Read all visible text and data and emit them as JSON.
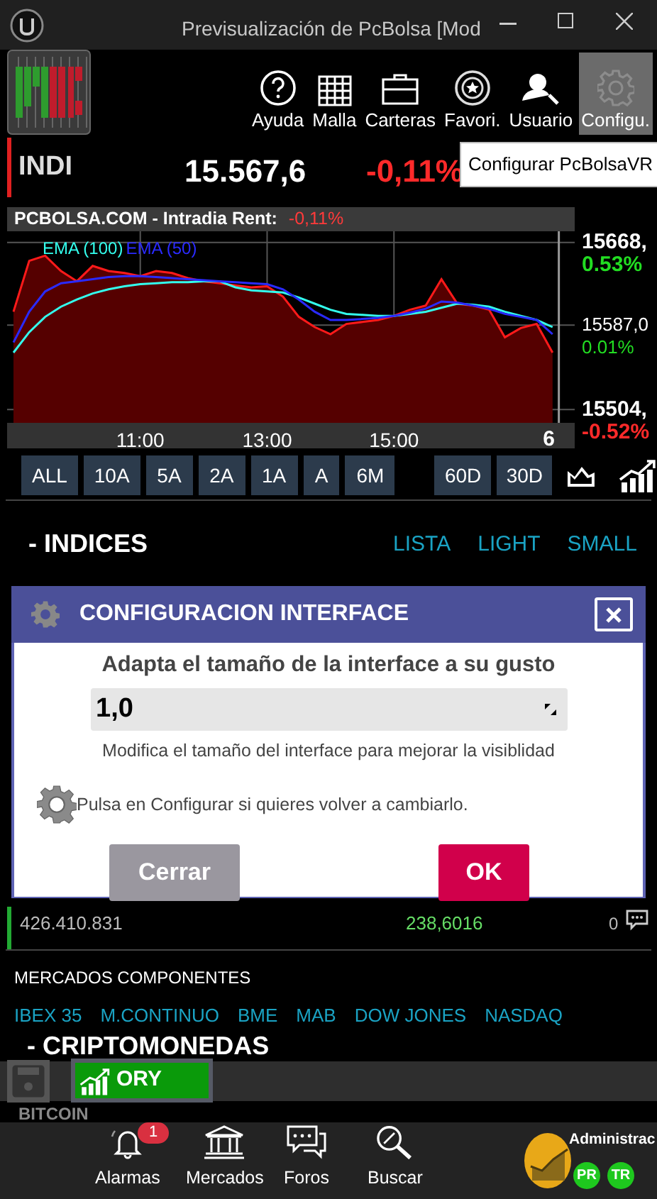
{
  "window": {
    "title": "Previsualización de PcBolsa [Mod"
  },
  "toolbar": [
    {
      "label": "Ayuda",
      "selected": false
    },
    {
      "label": "Malla",
      "selected": false
    },
    {
      "label": "Carteras",
      "selected": false
    },
    {
      "label": "Favori.",
      "selected": false
    },
    {
      "label": "Usuario",
      "selected": false
    },
    {
      "label": "Configu.",
      "selected": true
    }
  ],
  "quote": {
    "symbol": "INDI",
    "price": "15.567,6",
    "change": "-0,11%"
  },
  "tooltip": "Configurar PcBolsaVR",
  "chart_panel": {
    "header": "PCBOLSA.COM - Intradia  Rent:",
    "rent": "-0,11%",
    "day_marker": "6",
    "change_labels": [
      {
        "text": "0.53%",
        "kind": "up"
      },
      {
        "text": "0.01%",
        "kind": "up"
      },
      {
        "text": "-0.52%",
        "kind": "down"
      }
    ],
    "chart_data": {
      "type": "area",
      "x": [
        9,
        9.25,
        9.5,
        9.75,
        10,
        10.25,
        10.5,
        10.75,
        11,
        11.25,
        11.5,
        11.75,
        12,
        12.25,
        12.5,
        12.75,
        13,
        13.25,
        13.5,
        13.75,
        14,
        14.25,
        14.5,
        14.75,
        15,
        15.25,
        15.5,
        15.75,
        16,
        16.25,
        16.5,
        16.75,
        17,
        17.25,
        17.5
      ],
      "series": [
        {
          "color": "#ff1a1a",
          "values": [
            15600,
            15650,
            15655,
            15640,
            15630,
            15645,
            15640,
            15638,
            15635,
            15640,
            15638,
            15633,
            15630,
            15628,
            15626,
            15624,
            15625,
            15615,
            15595,
            15585,
            15578,
            15588,
            15590,
            15592,
            15596,
            15602,
            15606,
            15632,
            15608,
            15606,
            15602,
            15575,
            15584,
            15588,
            15560
          ]
        },
        {
          "name": "EMA (100)",
          "type": "line",
          "color": "#33ffee",
          "values": [
            15560,
            15580,
            15595,
            15605,
            15612,
            15618,
            15622,
            15625,
            15627,
            15628,
            15629,
            15629,
            15630,
            15630,
            15624,
            15621,
            15620,
            15619,
            15614,
            15608,
            15602,
            15598,
            15597,
            15596,
            15596,
            15598,
            15600,
            15604,
            15608,
            15607,
            15605,
            15600,
            15596,
            15592,
            15585
          ]
        },
        {
          "name": "EMA (50)",
          "type": "line",
          "color": "#2a2aff",
          "values": [
            15570,
            15600,
            15620,
            15628,
            15630,
            15632,
            15634,
            15635,
            15635,
            15634,
            15633,
            15632,
            15631,
            15630,
            15629,
            15628,
            15627,
            15622,
            15612,
            15600,
            15592,
            15592,
            15593,
            15594,
            15596,
            15599,
            15603,
            15610,
            15609,
            15606,
            15603,
            15598,
            15595,
            15592,
            15578
          ]
        }
      ],
      "grid": true,
      "xlim": [
        8.9,
        17.85
      ],
      "ylim": [
        15491,
        15679
      ],
      "xticks": [
        {
          "value": 11,
          "label": "11:00"
        },
        {
          "value": 13,
          "label": "13:00"
        },
        {
          "value": 15,
          "label": "15:00"
        }
      ],
      "yticks": [
        {
          "value": 15668,
          "label": "15668,"
        },
        {
          "value": 15587,
          "label": "15587,0"
        },
        {
          "value": 15504,
          "label": "15504,"
        }
      ]
    }
  },
  "periods": [
    "ALL",
    "10A",
    "5A",
    "2A",
    "1A",
    "A",
    "6M",
    "60D",
    "30D"
  ],
  "indices": {
    "title": "- INDICES",
    "views": [
      "LISTA",
      "LIGHT",
      "SMALL"
    ]
  },
  "dialog": {
    "title": "CONFIGURACION INTERFACE",
    "heading": "Adapta el tamaño de la interface a su gusto",
    "value": "1,0",
    "help": "Modifica el tamaño del interface para mejorar la visiblidad",
    "note": "Pulsa en Configurar si quieres volver a cambiarlo.",
    "buttons": [
      {
        "label": "Cerrar",
        "kind": "cancel"
      },
      {
        "label": "OK",
        "kind": "primary"
      }
    ]
  },
  "index_row": {
    "volume": "426.410.831",
    "value": "238,6016",
    "comments": "0"
  },
  "components": {
    "title": "MERCADOS COMPONENTES",
    "markets": [
      "IBEX 35",
      "M.CONTINUO",
      "BME",
      "MAB",
      "DOW JONES",
      "NASDAQ"
    ]
  },
  "crypto": {
    "title": "- CRIPTOMONEDAS",
    "first": "BITCOIN"
  },
  "quick_button": {
    "label": "ORY"
  },
  "nav": [
    {
      "label": "Alarmas",
      "badge": "1"
    },
    {
      "label": "Mercados"
    },
    {
      "label": "Foros"
    },
    {
      "label": "Buscar"
    }
  ],
  "user": {
    "name": "Administrac",
    "badges": [
      "PR",
      "TR"
    ]
  }
}
